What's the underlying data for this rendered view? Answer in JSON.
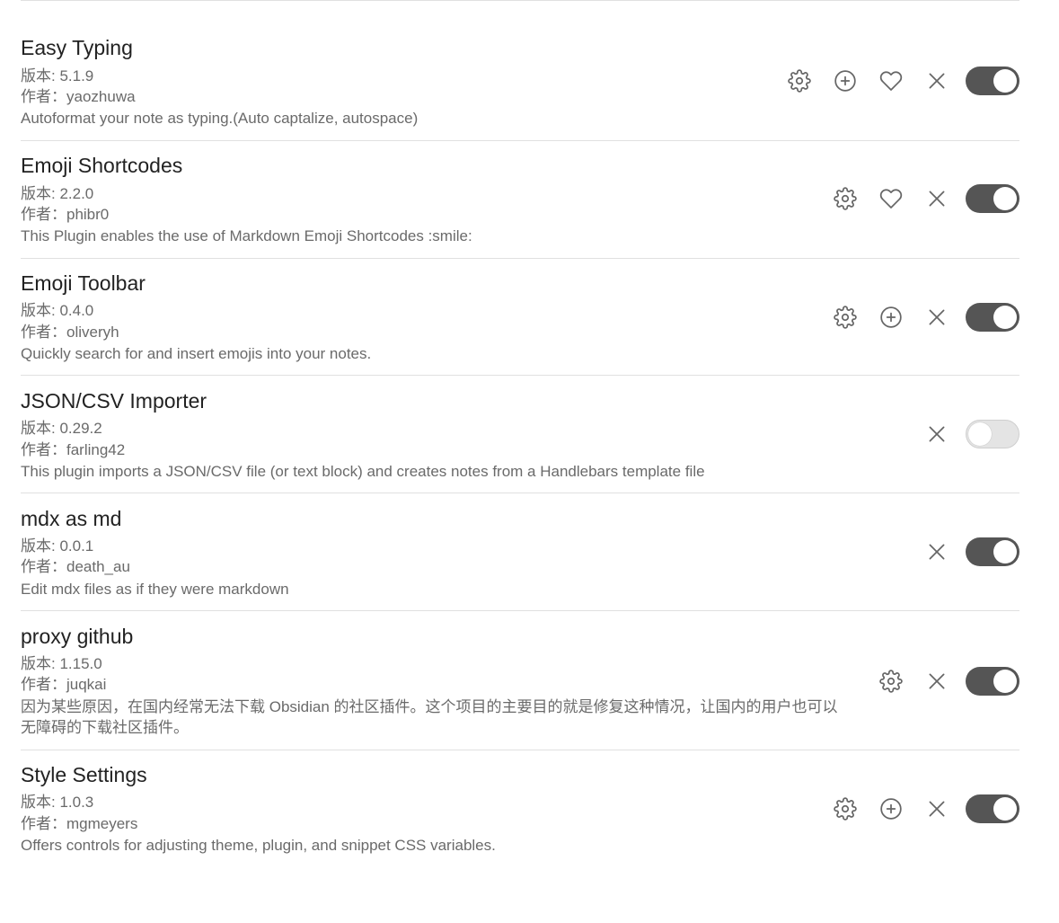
{
  "plugins": [
    {
      "name": "Easy Typing",
      "version": "版本: 5.1.9",
      "author": "作者：yaozhuwa",
      "description": "Autoformat your note as typing.(Auto captalize, autospace)",
      "enabled": true
    },
    {
      "name": "Emoji Shortcodes",
      "version": "版本: 2.2.0",
      "author": "作者：phibr0",
      "description": "This Plugin enables the use of Markdown Emoji Shortcodes :smile:",
      "enabled": true
    },
    {
      "name": "Emoji Toolbar",
      "version": "版本: 0.4.0",
      "author": "作者：oliveryh",
      "description": "Quickly search for and insert emojis into your notes.",
      "enabled": true
    },
    {
      "name": "JSON/CSV Importer",
      "version": "版本: 0.29.2",
      "author": "作者：farling42",
      "description": "This plugin imports a JSON/CSV file (or text block) and creates notes from a Handlebars template file",
      "enabled": false
    },
    {
      "name": "mdx as md",
      "version": "版本: 0.0.1",
      "author": "作者：death_au",
      "description": "Edit mdx files as if they were markdown",
      "enabled": true
    },
    {
      "name": "proxy github",
      "version": "版本: 1.15.0",
      "author": "作者：juqkai",
      "description": "因为某些原因，在国内经常无法下载 Obsidian 的社区插件。这个项目的主要目的就是修复这种情况，让国内的用户也可以无障碍的下载社区插件。",
      "enabled": true
    },
    {
      "name": "Style Settings",
      "version": "版本: 1.0.3",
      "author": "作者：mgmeyers",
      "description": "Offers controls for adjusting theme, plugin, and snippet CSS variables.",
      "enabled": true
    }
  ],
  "icons": {
    "settings": "gear-icon",
    "hotkeys": "plus-circle-icon",
    "donate": "heart-icon",
    "uninstall": "close-icon"
  },
  "colors": {
    "toggle_on": "#555555",
    "toggle_off": "#e4e4e4",
    "icon": "#666666",
    "divider": "#e0e0e0"
  }
}
